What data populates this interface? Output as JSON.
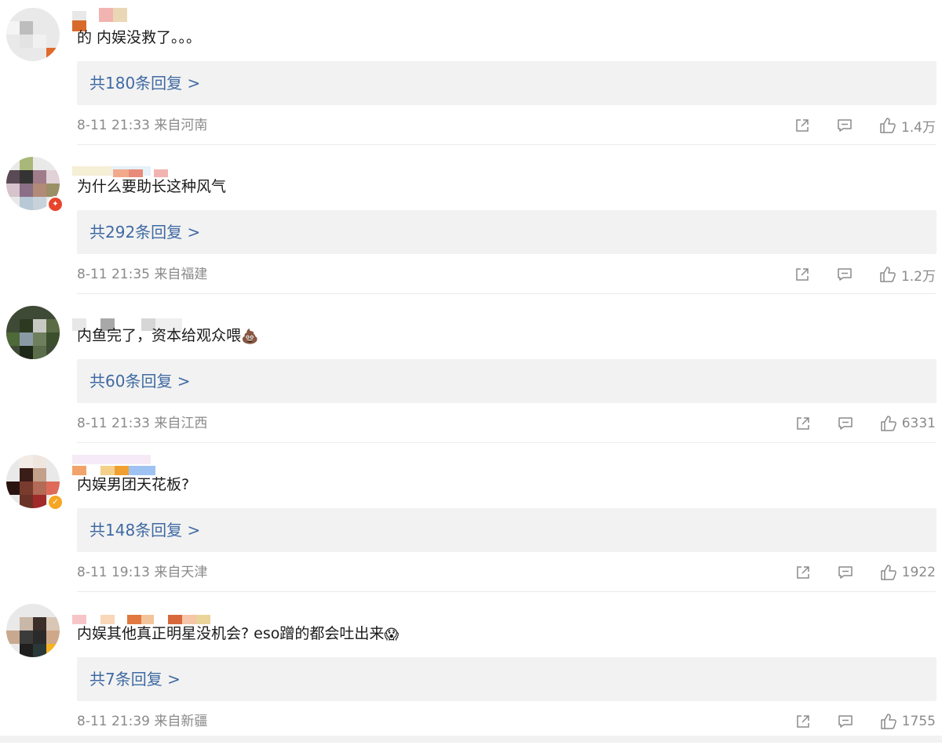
{
  "comments": [
    {
      "text": "的 内娱没救了。。。",
      "replies_label": "共180条回复 >",
      "meta": "8-11 21:33  来自河南",
      "likes": "1.4万"
    },
    {
      "text": "为什么要助长这种风气",
      "replies_label": "共292条回复 >",
      "meta": "8-11 21:35  来自福建",
      "likes": "1.2万"
    },
    {
      "text": "内鱼完了，资本给观众喂",
      "emoji": "💩",
      "replies_label": "共60条回复 >",
      "meta": "8-11 21:33  来自江西",
      "likes": "6331"
    },
    {
      "text": "内娱男团天花板?",
      "replies_label": "共148条回复 >",
      "meta": "8-11 19:13  来自天津",
      "likes": "1922"
    },
    {
      "text": "内娱其他真正明星没机会? eso蹭的都会吐出来",
      "emoji": "😱",
      "replies_label": "共7条回复 >",
      "meta": "8-11 21:39  来自新疆",
      "likes": "1755"
    }
  ],
  "icons": {
    "share": "share-icon",
    "reply": "comment-icon",
    "like": "thumbs-up-icon"
  },
  "colors": {
    "link": "#3f6aa3",
    "meta": "#8a8a8a",
    "reply_bg": "#f2f2f2",
    "badge": "#e8452c"
  }
}
